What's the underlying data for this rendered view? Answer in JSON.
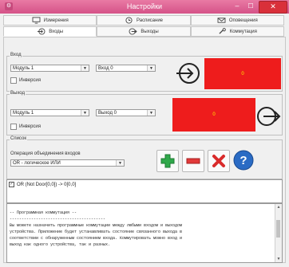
{
  "window": {
    "title": "Настройки",
    "min_glyph": "–",
    "max_glyph": "☐",
    "close_glyph": "✕",
    "icon_glyph": "⚙"
  },
  "tabs_top": [
    {
      "label": "Измерения",
      "icon": "monitor-icon"
    },
    {
      "label": "Расписание",
      "icon": "clock-icon"
    },
    {
      "label": "Оповещения",
      "icon": "envelope-icon"
    }
  ],
  "tabs_bottom": [
    {
      "label": "Входы",
      "icon": "enter-arrow-icon",
      "active": true
    },
    {
      "label": "Выходы",
      "icon": "exit-arrow-icon"
    },
    {
      "label": "Коммутация",
      "icon": "wrench-icon"
    }
  ],
  "input_group": {
    "title": "Вход",
    "module": "Модуль 1",
    "port": "Вход 0",
    "inversion_label": "Инверсия",
    "state_value": "0",
    "state_color": "#ee1c1c"
  },
  "output_group": {
    "title": "Выход",
    "module": "Модуль 1",
    "port": "Выход 0",
    "inversion_label": "Инверсия",
    "state_value": "0",
    "state_color": "#ee1c1c"
  },
  "list_group": {
    "title": "Список",
    "operation_label": "Операция объединения входов",
    "operation_value": "OR - логическое ИЛИ",
    "items": [
      "OR (Not Door[0,0]) -> 0[0,0]"
    ],
    "buttons": [
      "add-icon",
      "remove-icon",
      "delete-icon",
      "help-icon"
    ]
  },
  "help_text": {
    "heading": "-- Программная коммутация --",
    "rule": "----------------------------------------",
    "lines": [
      "Вы можете назначить программные коммутации между любыми входом и выходом",
      "устройства. Приложение будет устанавливать состояние связанного выхода в",
      "соответствии с обнаруженным состоянием входа. Коммутировать можно вход и",
      "выход как одного устройства, так и разных."
    ]
  },
  "colors": {
    "accent": "#d55288",
    "state_off": "#ee1c1c",
    "state_text": "#ffee00"
  }
}
